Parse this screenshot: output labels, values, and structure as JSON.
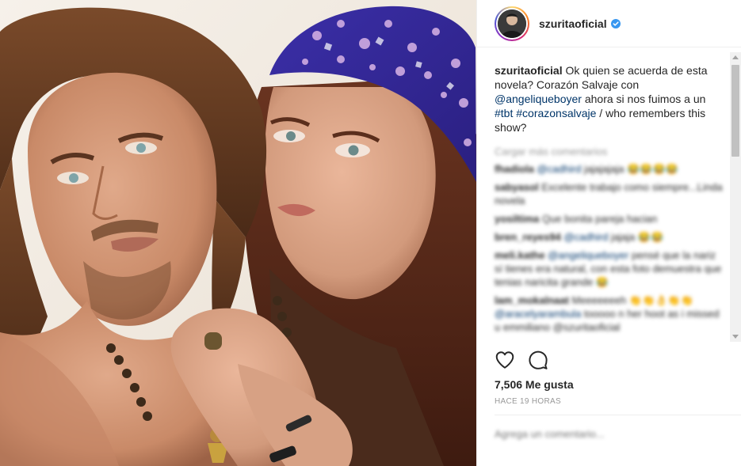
{
  "post": {
    "photo": {
      "alt_icon": "post-photo"
    }
  },
  "header": {
    "username": "szuritaoficial",
    "verified_icon": "verified-badge-icon",
    "verified_color": "#3897f0"
  },
  "caption": {
    "username": "szuritaoficial",
    "text_1": " Ok quien se acuerda de esta novela? Corazón Salvaje con ",
    "mention": "@angeliqueboyer",
    "text_2": " ahora si nos fuimos a un ",
    "hashtag_1": "#tbt",
    "space": " ",
    "hashtag_2": "#corazonsalvaje",
    "text_3": " / who remembers this show?"
  },
  "comments": {
    "load_more": "Cargar más comentarios",
    "items": [
      {
        "user": "fhadiola",
        "pre": " ",
        "link": "@cadhird",
        "text": " jajajajaja 😂😂😂😂"
      },
      {
        "user": "sabyasol",
        "pre": " Excelente trabajo como siempre...Linda novela",
        "link": "",
        "text": ""
      },
      {
        "user": "yosiltima",
        "pre": " Que bonita pareja hacian",
        "link": "",
        "text": ""
      },
      {
        "user": "bren_reyes94",
        "pre": " ",
        "link": "@cadhird",
        "text": " jajaja 😂😂"
      },
      {
        "user": "meli.kathe",
        "pre": " ",
        "link": "@angeliqueboyer",
        "text": " pensé que la nariz sí tienes era natural, con esta foto demuestra que tenias naricita grande 😂"
      },
      {
        "user": "lam_mokalnaat",
        "pre": " Meeeeeeeh 👏👏👌👏👏",
        "link": "@aracelyarambula",
        "text": " tooooo n her hoot as i missed u emmiliano @szuritaoficial"
      }
    ]
  },
  "actions": {
    "like_icon": "heart-icon",
    "comment_icon": "comment-icon"
  },
  "likes": "7,506 Me gusta",
  "time_ago": "HACE 19 HORAS",
  "add_comment_placeholder": "Agrega un comentario..."
}
